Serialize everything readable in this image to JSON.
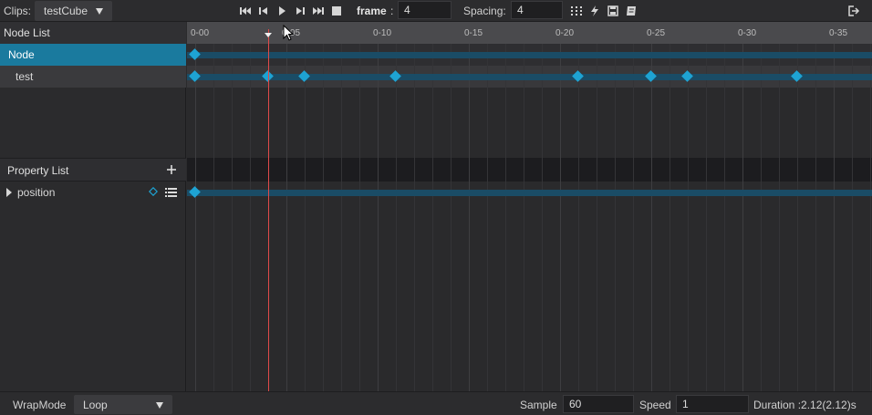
{
  "toolbar": {
    "clips_label": "Clips:",
    "clip_value": "testCube",
    "frame_label": "frame",
    "frame_colon": ":",
    "frame_value": "4",
    "spacing_label": "Spacing:",
    "spacing_value": "4",
    "icons": [
      "first-frame-icon",
      "prev-frame-icon",
      "play-icon",
      "next-frame-icon",
      "last-frame-icon",
      "stop-icon",
      "grid-icon",
      "event-icon",
      "save-icon",
      "book-icon",
      "exit-icon"
    ]
  },
  "node_list": {
    "header": "Node List",
    "items": [
      {
        "label": "Node",
        "selected": true
      },
      {
        "label": "test",
        "selected": false
      }
    ]
  },
  "property_list": {
    "header": "Property List",
    "items": [
      {
        "label": "position"
      }
    ]
  },
  "timeline": {
    "ticks": [
      "0-00",
      "0-05",
      "0-10",
      "0-15",
      "0-20",
      "0-25",
      "0-30",
      "0-35"
    ],
    "current_frame": 4,
    "keyframes": {
      "Node": [
        0
      ],
      "test": [
        0,
        4,
        6,
        11,
        21,
        25,
        27,
        33
      ],
      "position": [
        0
      ]
    }
  },
  "bottom": {
    "wrap_label": "WrapMode",
    "wrap_value": "Loop",
    "sample_label": "Sample",
    "sample_value": "60",
    "speed_label": "Speed",
    "speed_value": "1",
    "duration_label": "Duration :2.12(2.12)s"
  },
  "colors": {
    "accent": "#1ea3d3",
    "selected_row": "#1a7a9e",
    "track": "#1a4c66",
    "playhead": "#e04a4a"
  }
}
